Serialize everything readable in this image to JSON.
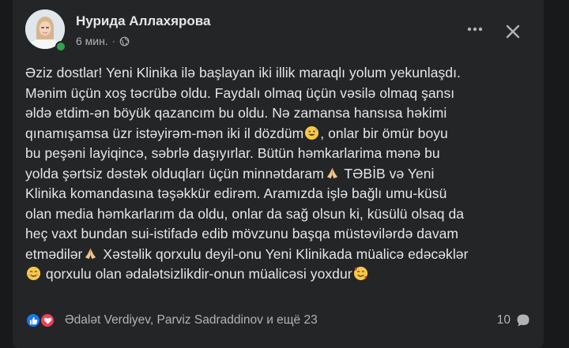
{
  "post": {
    "author": "Нурида Аллахярова",
    "time": "6 мин.",
    "separator": "·",
    "privacy_icon": "globe-icon",
    "lines": [
      "Əziz dostlar! Yeni Klinika ilə başlayan iki illik maraqlı yolum yekunlaşdı.",
      "Mənim üçün xoş təcrübə oldu. Faydalı olmaq üçün vəsilə olmaq şansı",
      "əldə etdim-ən böyük qazancım bu oldu. Nə zamansa hansısa həkimi",
      {
        "before": "qınamışamsa üzr istəyirəm-mən iki il dözdüm",
        "emoji": "grinning-sweat-emoji",
        "after": ", onlar bir ömür boyu"
      },
      "bu peşəni layiqincə, səbrlə daşıyırlar. Bütün həmkarlarima mənə bu",
      {
        "before": "yolda şərtsiz dəstək olduqları üçün minnətdaram",
        "emoji": "folded-hands-emoji",
        "after": " TƏBİB və Yeni"
      },
      "Klinika komandasına təşəkkür edirəm. Aramızda işlə bağlı umu-küsü",
      "olan media həmkarlarım da oldu, onlar da sağ olsun ki, küsülü olsaq da",
      "heç vaxt bundan sui-istifadə edib mövzunu başqa müstəvilərdə davam",
      {
        "before": "etmədilər",
        "emoji": "folded-hands-emoji",
        "after": " Xəstəlik qorxulu deyil-onu Yeni Klinikada müalicə edəcəklər"
      },
      {
        "before": "",
        "emoji": "smiling-emoji",
        "after": " qorxulu olan ədalətsizlikdir-onun müalicəsi yoxdur",
        "emoji2": "smiling-hearts-emoji"
      }
    ]
  },
  "reactions": {
    "icons": [
      "like-icon",
      "love-icon"
    ],
    "names": "Ədalət Verdiyev, Parviz Sadraddinov и ещё 23",
    "comment_count": "10"
  },
  "colors": {
    "background": "#242526",
    "text": "#e4e6eb",
    "secondary": "#b0b3b8",
    "like": "#1877f2",
    "love": "#f33e58",
    "online": "#31a24c"
  }
}
